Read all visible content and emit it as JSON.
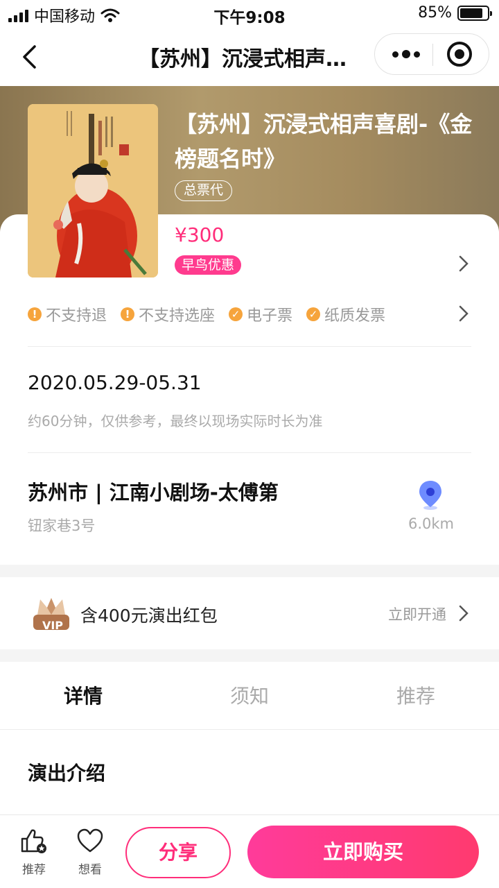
{
  "status_bar": {
    "carrier": "中国移动",
    "time": "下午9:08",
    "battery_percent_text": "85%",
    "battery_level": 0.85
  },
  "nav": {
    "title": "【苏州】沉浸式相声…",
    "more_icon": "more-dots-icon",
    "close_icon": "target-close-icon"
  },
  "show": {
    "title": "【苏州】沉浸式相声喜剧-《金榜题名时》",
    "agent_tag": "总票代",
    "price": "¥300",
    "promo_tag": "早鸟优惠",
    "poster_icon": "opera-poster-image"
  },
  "policies": [
    {
      "label": "不支持退",
      "type": "warning",
      "icon": "exclamation-icon"
    },
    {
      "label": "不支持选座",
      "type": "warning",
      "icon": "exclamation-icon"
    },
    {
      "label": "电子票",
      "type": "supported",
      "icon": "check-icon"
    },
    {
      "label": "纸质发票",
      "type": "supported",
      "icon": "check-icon"
    }
  ],
  "schedule": {
    "date": "2020.05.29-05.31",
    "duration_note": "约60分钟，仅供参考，最终以现场实际时长为准"
  },
  "venue": {
    "name": "苏州市 | 江南小剧场-太傅第",
    "address": "钮家巷3号",
    "distance": "6.0km",
    "pin_icon": "location-pin-icon"
  },
  "vip": {
    "badge_text": "VIP",
    "text": "含400元演出红包",
    "action": "立即开通"
  },
  "tabs": [
    {
      "label": "详情",
      "active": true
    },
    {
      "label": "须知",
      "active": false
    },
    {
      "label": "推荐",
      "active": false
    }
  ],
  "section": {
    "title": "演出介绍"
  },
  "bottom_bar": {
    "recommend_label": "推荐",
    "want_label": "想看",
    "share_label": "分享",
    "buy_label": "立即购买"
  },
  "colors": {
    "accent": "#ff2d7a",
    "warning": "#f6a43c",
    "banner": "#a58c5f"
  }
}
